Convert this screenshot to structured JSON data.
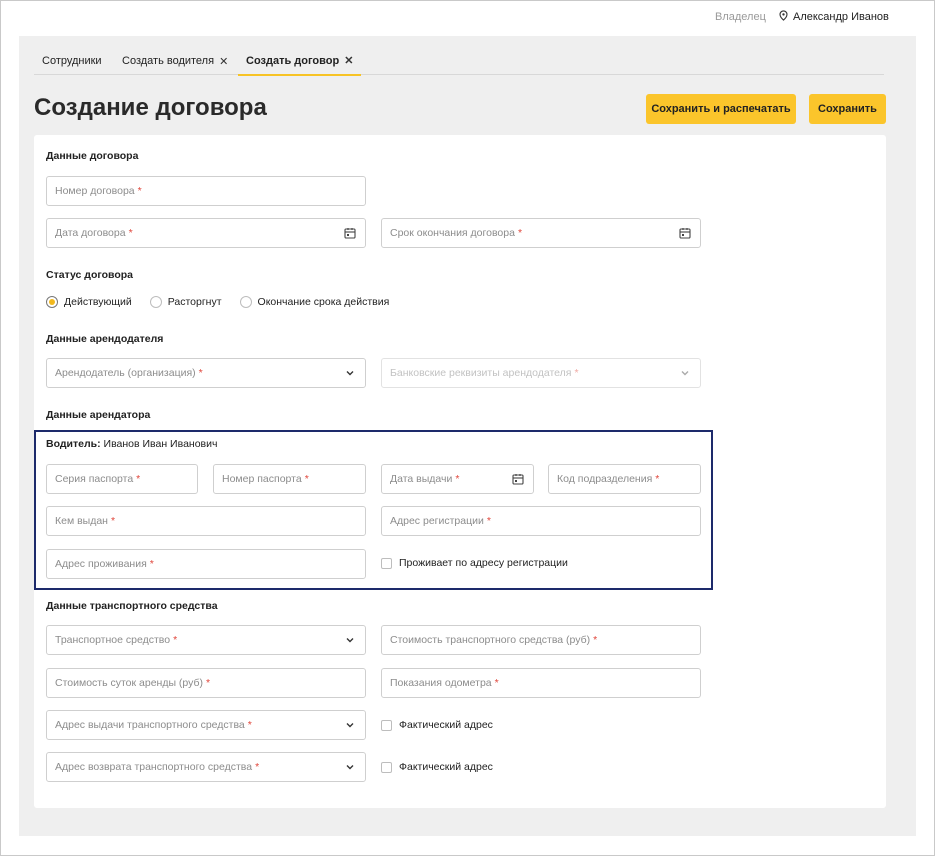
{
  "header": {
    "owner_label": "Владелец",
    "user_name": "Александр Иванов"
  },
  "tabs": [
    {
      "label": "Сотрудники",
      "closable": false,
      "active": false
    },
    {
      "label": "Создать водителя",
      "closable": true,
      "active": false
    },
    {
      "label": "Создать договор",
      "closable": true,
      "active": true
    }
  ],
  "page": {
    "title": "Создание договора",
    "save_print_label": "Сохранить и распечатать",
    "save_label": "Сохранить"
  },
  "contract": {
    "section_title": "Данные договора",
    "number_placeholder": "Номер договора",
    "date_placeholder": "Дата договора",
    "end_date_placeholder": "Срок окончания договора"
  },
  "status": {
    "section_title": "Статус договора",
    "options": [
      {
        "label": "Действующий",
        "checked": true
      },
      {
        "label": "Расторгнут",
        "checked": false
      },
      {
        "label": "Окончание срока действия",
        "checked": false
      }
    ]
  },
  "landlord": {
    "section_title": "Данные арендодателя",
    "org_placeholder": "Арендодатель (организация)",
    "bank_placeholder": "Банковские реквизиты арендодателя"
  },
  "tenant": {
    "section_title": "Данные арендатора",
    "driver_label": "Водитель:",
    "driver_name": "Иванов Иван Иванович",
    "passport_series_placeholder": "Серия паспорта",
    "passport_number_placeholder": "Номер паспорта",
    "issue_date_placeholder": "Дата выдачи",
    "division_code_placeholder": "Код подразделения",
    "issued_by_placeholder": "Кем выдан",
    "registration_address_placeholder": "Адрес регистрации",
    "residence_address_placeholder": "Адрес проживания",
    "same_address_label": "Проживает по адресу регистрации"
  },
  "vehicle": {
    "section_title": "Данные транспортного средства",
    "vehicle_placeholder": "Транспортное средство",
    "vehicle_cost_placeholder": "Стоимость транспортного средства (руб)",
    "daily_cost_placeholder": "Стоимость суток аренды (руб)",
    "odometer_placeholder": "Показания одометра",
    "issue_address_placeholder": "Адрес выдачи транспортного средства",
    "actual_address_label_1": "Фактический адрес",
    "return_address_placeholder": "Адрес возврата транспортного средства",
    "actual_address_label_2": "Фактический адрес"
  },
  "required_mark": "*",
  "colors": {
    "accent": "#fbc52b",
    "highlight_border": "#1d2a6b",
    "required": "#e0453a"
  }
}
